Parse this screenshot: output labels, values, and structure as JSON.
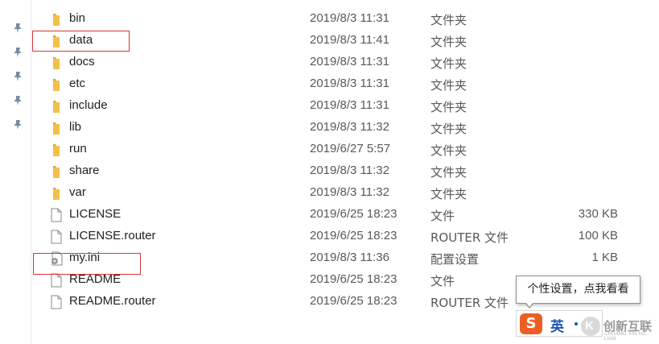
{
  "files": [
    {
      "name": "bin",
      "date": "2019/8/3 11:31",
      "type": "文件夹",
      "size": "",
      "icon": "folder-icon"
    },
    {
      "name": "data",
      "date": "2019/8/3 11:41",
      "type": "文件夹",
      "size": "",
      "icon": "folder-icon"
    },
    {
      "name": "docs",
      "date": "2019/8/3 11:31",
      "type": "文件夹",
      "size": "",
      "icon": "folder-icon"
    },
    {
      "name": "etc",
      "date": "2019/8/3 11:31",
      "type": "文件夹",
      "size": "",
      "icon": "folder-icon"
    },
    {
      "name": "include",
      "date": "2019/8/3 11:31",
      "type": "文件夹",
      "size": "",
      "icon": "folder-icon"
    },
    {
      "name": "lib",
      "date": "2019/8/3 11:32",
      "type": "文件夹",
      "size": "",
      "icon": "folder-icon"
    },
    {
      "name": "run",
      "date": "2019/6/27 5:57",
      "type": "文件夹",
      "size": "",
      "icon": "folder-icon"
    },
    {
      "name": "share",
      "date": "2019/8/3 11:32",
      "type": "文件夹",
      "size": "",
      "icon": "folder-icon"
    },
    {
      "name": "var",
      "date": "2019/8/3 11:32",
      "type": "文件夹",
      "size": "",
      "icon": "folder-icon"
    },
    {
      "name": "LICENSE",
      "date": "2019/6/25 18:23",
      "type": "文件",
      "size": "330 KB",
      "icon": "file-icon"
    },
    {
      "name": "LICENSE.router",
      "date": "2019/6/25 18:23",
      "type": "ROUTER 文件",
      "size": "100 KB",
      "icon": "file-icon"
    },
    {
      "name": "my.ini",
      "date": "2019/8/3 11:36",
      "type": "配置设置",
      "size": "1 KB",
      "icon": "config-file-icon"
    },
    {
      "name": "README",
      "date": "2019/6/25 18:23",
      "type": "文件",
      "size": "",
      "icon": "file-icon"
    },
    {
      "name": "README.router",
      "date": "2019/6/25 18:23",
      "type": "ROUTER 文件",
      "size": "",
      "icon": "file-icon"
    }
  ],
  "tooltip": {
    "text": "个性设置，点我看看"
  },
  "ime": {
    "logo": "S",
    "mode": "英"
  },
  "watermark": {
    "logo": "K",
    "text": "创新互联",
    "sub": "CHUANG XIN HU LIAN"
  },
  "colors": {
    "folder": "#f2c04d",
    "highlight": "#d9343a",
    "ime_logo": "#ec5f23",
    "ime_mode": "#1a56b3"
  }
}
